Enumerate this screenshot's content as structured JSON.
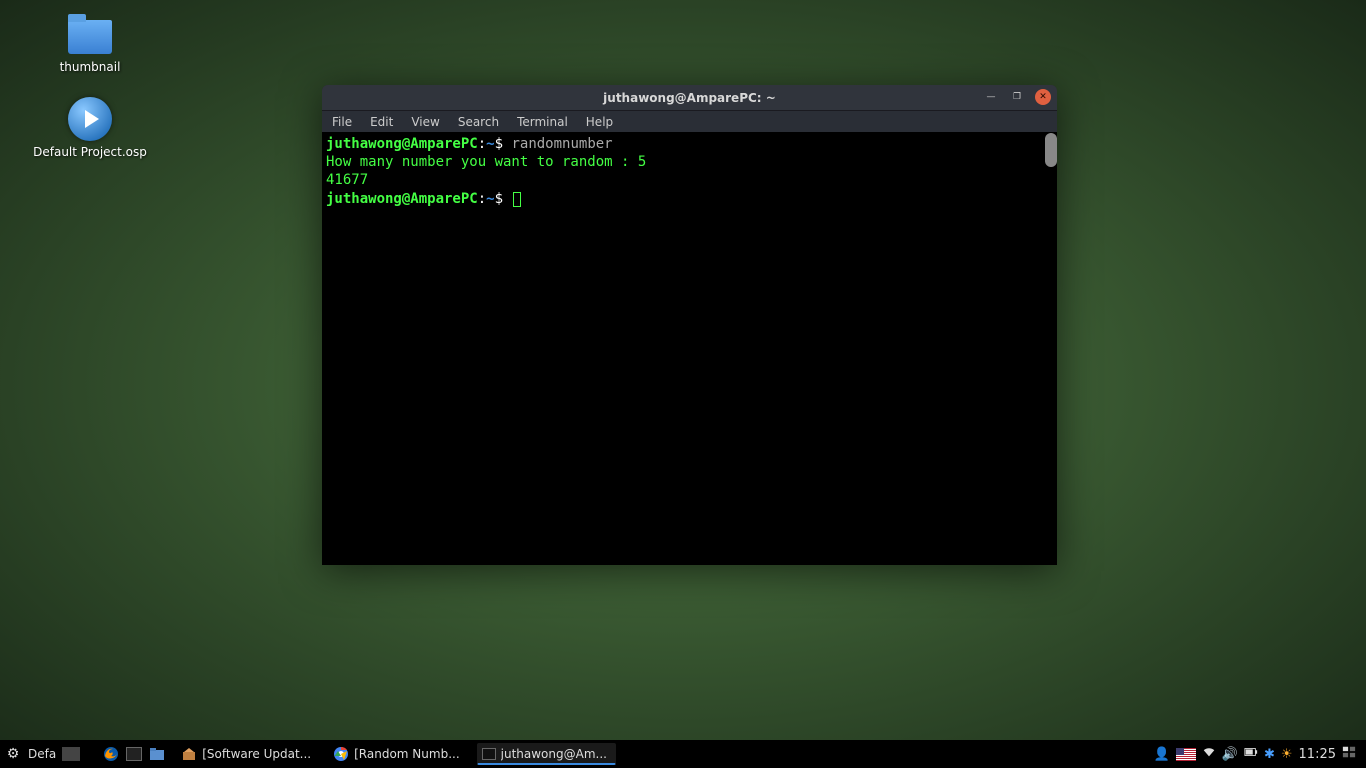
{
  "desktop": {
    "icons": [
      {
        "label": "thumbnail"
      },
      {
        "label": "Default Project.osp"
      }
    ]
  },
  "terminal": {
    "title": "juthawong@AmparePC: ~",
    "menu": [
      "File",
      "Edit",
      "View",
      "Search",
      "Terminal",
      "Help"
    ],
    "prompt": {
      "user": "juthawong@AmparePC",
      "sep": ":",
      "path": "~",
      "sign": "$"
    },
    "lines": {
      "cmd1": "randomnumber",
      "out1": "How many number you want to random : 5",
      "out2": "41677"
    }
  },
  "panel": {
    "menu_label": "Defa",
    "tasks": [
      {
        "label": "[Software Updat..."
      },
      {
        "label": "[Random Numb..."
      },
      {
        "label": "juthawong@Am..."
      }
    ],
    "clock": "11:25"
  }
}
